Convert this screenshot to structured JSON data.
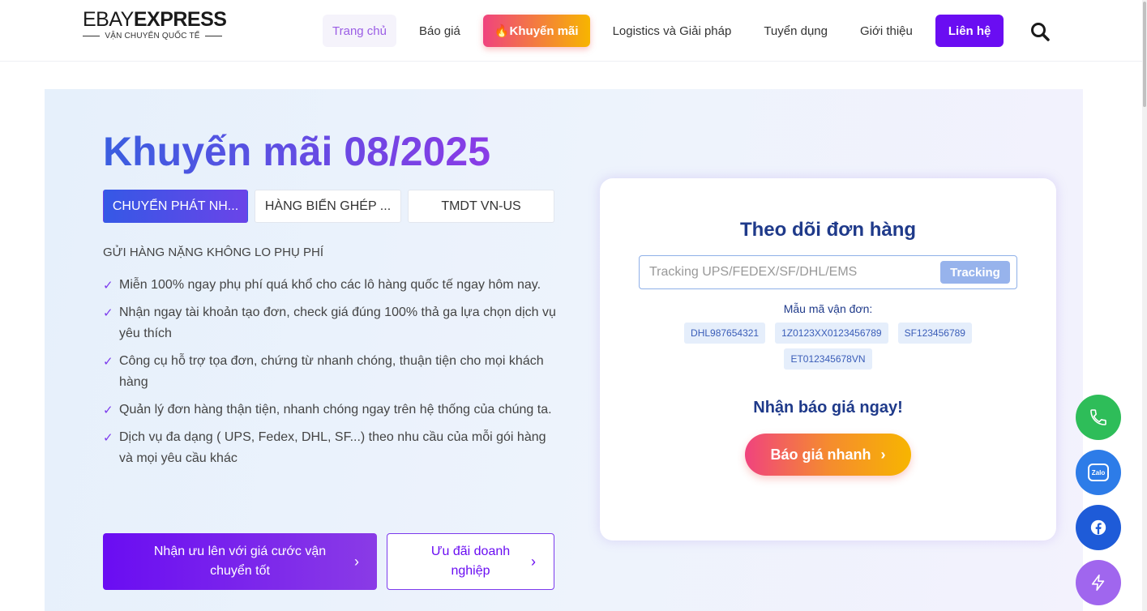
{
  "logo": {
    "brand_part1": "EBAY",
    "brand_part2": "EXPRESS",
    "tagline": "VẬN CHUYỂN QUỐC TẾ"
  },
  "nav": {
    "items": [
      {
        "label": "Trang chủ",
        "state": "active"
      },
      {
        "label": "Báo giá"
      },
      {
        "label": "🔥Khuyến mãi",
        "icon": "fire-icon"
      },
      {
        "label": "Logistics và Giải pháp"
      },
      {
        "label": "Tuyển dụng"
      },
      {
        "label": "Giới thiệu"
      },
      {
        "label": "Liên hệ"
      }
    ],
    "search_icon": "search-icon"
  },
  "hero": {
    "title": "Khuyến mãi 08/2025",
    "tabs": [
      {
        "label": "CHUYỂN PHÁT NH...",
        "state": "active"
      },
      {
        "label": "HÀNG BIỂN GHÉP ..."
      },
      {
        "label": "TMDT VN-US"
      }
    ],
    "subheading": "GỬI HÀNG NẶNG KHÔNG LO PHỤ PHÍ",
    "check_mark": "✓",
    "benefits": [
      "Miễn 100% ngay phụ phí quá khổ cho các lô hàng quốc tế ngay hôm nay.",
      "Nhận ngay tài khoản tạo đơn, check giá đúng 100% thả ga lựa chọn dịch vụ yêu thích",
      "Công cụ hỗ trợ tọa đơn, chứng từ nhanh chóng, thuận tiện cho mọi khách hàng",
      "Quản lý đơn hàng thận tiện, nhanh chóng ngay trên hệ thống của chúng ta.",
      "Dịch vụ đa dạng ( UPS, Fedex, DHL, SF...) theo nhu cầu của mỗi gói hàng và mọi yêu cầu khác"
    ],
    "cta_primary": "Nhận ưu lên với giá cước vận chuyển tốt",
    "cta_secondary": "Ưu đãi doanh nghiệp",
    "chevron": "›"
  },
  "tracking": {
    "title": "Theo dõi đơn hàng",
    "input_placeholder": "Tracking UPS/FEDEX/SF/DHL/EMS",
    "button_label": "Tracking",
    "sample_label": "Mẫu mã vận đơn:",
    "sample_codes": [
      "DHL987654321",
      "1Z0123XX0123456789",
      "SF123456789",
      "ET012345678VN"
    ],
    "quote_title": "Nhận báo giá ngay!",
    "quote_button": "Báo giá nhanh",
    "quote_chevron": "›"
  },
  "floating": {
    "zalo_label": "Zalo",
    "buttons": [
      "phone-icon",
      "zalo-icon",
      "facebook-icon",
      "flash-icon"
    ]
  },
  "colors": {
    "accent_purple": "#6a0df2",
    "title_blue": "#1f3a8a",
    "promo_gradient_start": "#f0437e",
    "promo_gradient_end": "#f7b500",
    "phone_green": "#2ebd59",
    "facebook_blue": "#1e5bd8"
  }
}
